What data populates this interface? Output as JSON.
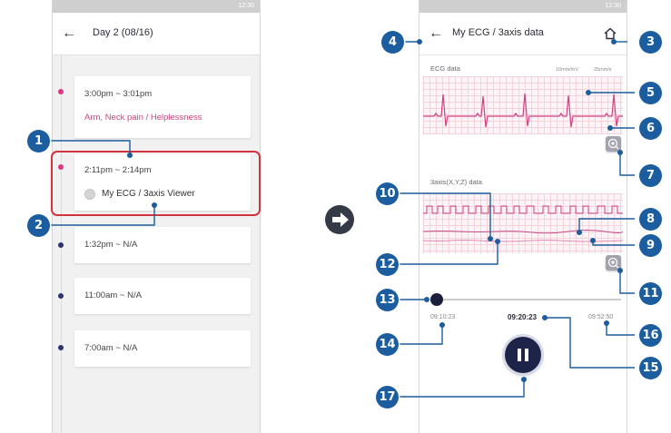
{
  "status_bar": {
    "time": "12:30"
  },
  "left_screen": {
    "title": "Day 2 (08/16)",
    "cards": [
      {
        "time": "3:00pm ~ 3:01pm",
        "symptom": "Arm, Neck pain / Helplessness"
      },
      {
        "time": "2:11pm ~ 2:14pm",
        "link_label": "My ECG / 3axis Viewer"
      },
      {
        "time": "1:32pm ~ N/A"
      },
      {
        "time": "11:00am ~ N/A"
      },
      {
        "time": "7:00am ~ N/A"
      }
    ]
  },
  "right_screen": {
    "title": "My ECG / 3axis data",
    "ecg_label": "ECG data",
    "ecg_scale_voltage": "10mm/mV",
    "ecg_scale_speed": "25mm/s",
    "axis_label": "3axis(X,Y,Z) data",
    "playback": {
      "start_time": "09:10:23",
      "current_time": "09:20:23",
      "end_time": "09:52:50",
      "progress": 0.02
    }
  },
  "callouts": [
    "1",
    "2",
    "3",
    "4",
    "5",
    "6",
    "7",
    "8",
    "9",
    "10",
    "11",
    "12",
    "13",
    "14",
    "15",
    "16",
    "17"
  ],
  "colors": {
    "accent_pink": "#e0367f",
    "navy": "#1d2349",
    "callout_blue": "#1b5d9e",
    "highlight_red": "#d1343f"
  }
}
